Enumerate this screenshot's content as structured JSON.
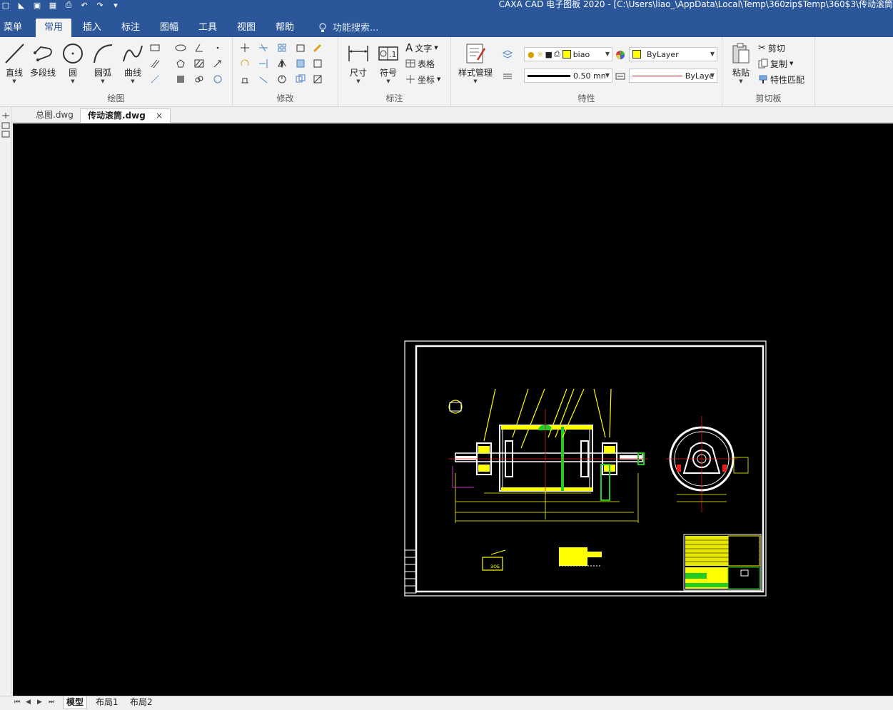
{
  "window": {
    "title": "CAXA CAD 电子图板 2020 - [C:\\Users\\liao_\\AppData\\Local\\Temp\\360zip$Temp\\360$3\\传动滚筒"
  },
  "tabs": [
    {
      "label": "菜单",
      "active": false
    },
    {
      "label": "常用",
      "active": true
    },
    {
      "label": "插入",
      "active": false
    },
    {
      "label": "标注",
      "active": false
    },
    {
      "label": "图幅",
      "active": false
    },
    {
      "label": "工具",
      "active": false
    },
    {
      "label": "视图",
      "active": false
    },
    {
      "label": "帮助",
      "active": false
    }
  ],
  "search": {
    "placeholder": "功能搜索..."
  },
  "groups": {
    "draw": {
      "label": "绘图",
      "buttons": [
        "直线",
        "多段线",
        "圆",
        "圆弧",
        "曲线"
      ]
    },
    "modify": {
      "label": "修改"
    },
    "annotate": {
      "label": "标注",
      "buttons": [
        "尺寸",
        "符号"
      ],
      "small": [
        "文字",
        "表格",
        "坐标"
      ]
    },
    "properties": {
      "label": "特性",
      "style_manager": "样式管理",
      "layer_value": "biao",
      "color_value": "ByLayer",
      "lineweight_value": "0.50 mn",
      "linetype_value": "ByLaye",
      "color_accent": "#ffff00"
    },
    "clipboard": {
      "label": "剪切板",
      "paste": "粘贴",
      "small": [
        "剪切",
        "复制",
        "特性匹配"
      ]
    }
  },
  "doc_tabs": [
    {
      "label": "总图.dwg",
      "active": false
    },
    {
      "label": "传动滚筒.dwg",
      "active": true,
      "close": "×"
    }
  ],
  "layout_tabs": [
    {
      "label": "模型",
      "active": true
    },
    {
      "label": "布局1",
      "active": false
    },
    {
      "label": "布局2",
      "active": false
    }
  ],
  "drawing_text": {
    "title_block_tag": "ЭОБ"
  }
}
